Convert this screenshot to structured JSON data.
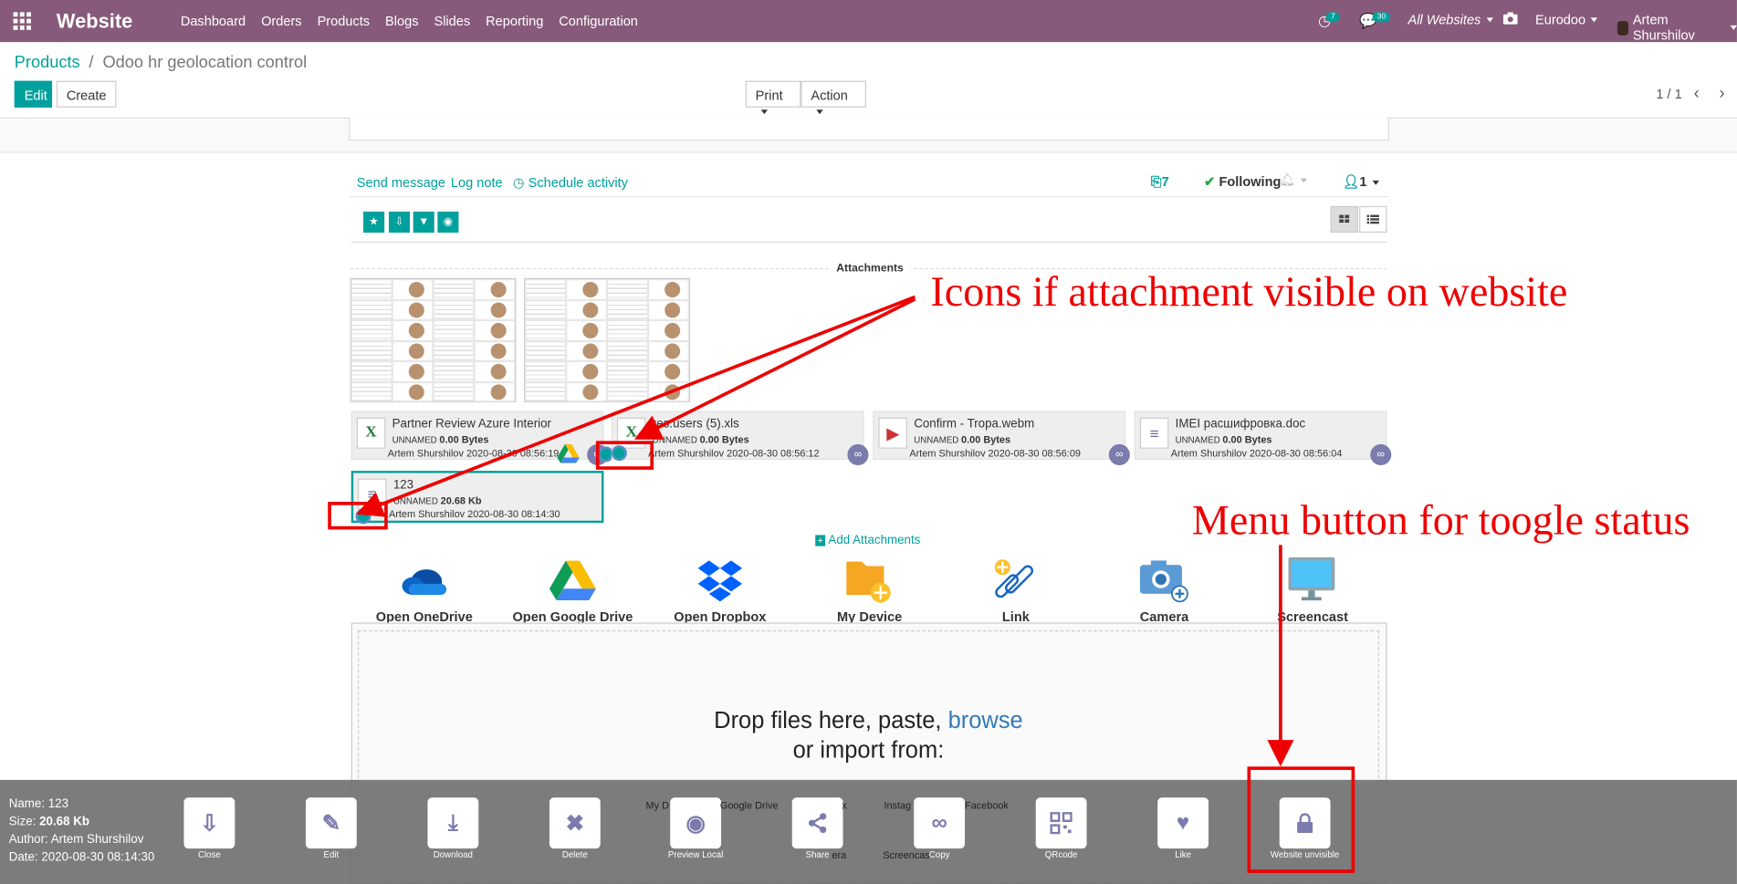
{
  "navbar": {
    "brand": "Website",
    "menu": [
      "Dashboard",
      "Orders",
      "Products",
      "Blogs",
      "Slides",
      "Reporting",
      "Configuration"
    ],
    "activity_count": "7",
    "message_count": "30",
    "website": "All Websites",
    "company": "Eurodoo",
    "user": "Artem Shurshilov"
  },
  "breadcrumb": {
    "parent": "Products",
    "separator": "/",
    "current": "Odoo hr geolocation control"
  },
  "buttons": {
    "edit": "Edit",
    "create": "Create",
    "print": "Print",
    "action": "Action"
  },
  "pager": "1 / 1",
  "chatter": {
    "send_message": "Send message",
    "log_note": "Log note",
    "schedule_activity": "Schedule activity",
    "attachments_count": "7",
    "following": "Following",
    "followers": "1"
  },
  "attachments": {
    "title": "Attachments",
    "cards": [
      {
        "name": "Partner Review Azure Interior",
        "tag": "UNNAMED",
        "size": "0.00 Bytes",
        "author": "Artem Shurshilov 2020-08-30 08:56:19"
      },
      {
        "name": "res.users (5).xls",
        "tag": "UNNAMED",
        "size": "0.00 Bytes",
        "author": "Artem Shurshilov 2020-08-30 08:56:12"
      },
      {
        "name": "Confirm - Tropa.webm",
        "tag": "UNNAMED",
        "size": "0.00 Bytes",
        "author": "Artem Shurshilov 2020-08-30 08:56:09"
      },
      {
        "name": "IMEI расшифровка.doc",
        "tag": "UNNAMED",
        "size": "0.00 Bytes",
        "author": "Artem Shurshilov 2020-08-30 08:56:04"
      },
      {
        "name": "123",
        "tag": "UNNAMED",
        "size": "20.68 Kb",
        "author": "Artem Shurshilov 2020-08-30 08:14:30"
      }
    ],
    "add": "Add Attachments",
    "sources": [
      "Open OneDrive",
      "Open Google Drive",
      "Open Dropbox",
      "My Device",
      "Link",
      "Camera",
      "Screencast"
    ],
    "drop_text": "Drop files here, paste,",
    "browse": "browse",
    "import_text": "or import from:",
    "import_sources_visible": [
      "My D",
      "Google Drive",
      "x",
      "Instag",
      "Facebook",
      "Screencas",
      "era"
    ]
  },
  "preview": {
    "name_label": "Name:",
    "name": "123",
    "size_label": "Size:",
    "size": "20.68 Kb",
    "author_label": "Author:",
    "author": "Artem Shurshilov",
    "date_label": "Date:",
    "date": "2020-08-30 08:14:30",
    "actions": [
      "Close",
      "Edit",
      "Download",
      "Delete",
      "Preview Local",
      "Share",
      "Copy",
      "QRcode",
      "Like",
      "Website unvisible"
    ]
  },
  "annotations": {
    "icons": "Icons if attachment visible on website",
    "menu": "Menu button for toogle status"
  },
  "colors": {
    "navbar": "#875a7b",
    "primary": "#00a09d",
    "annotation": "#e00000",
    "overlay": "#6e6e6e",
    "action_icon": "#7c7bad"
  }
}
